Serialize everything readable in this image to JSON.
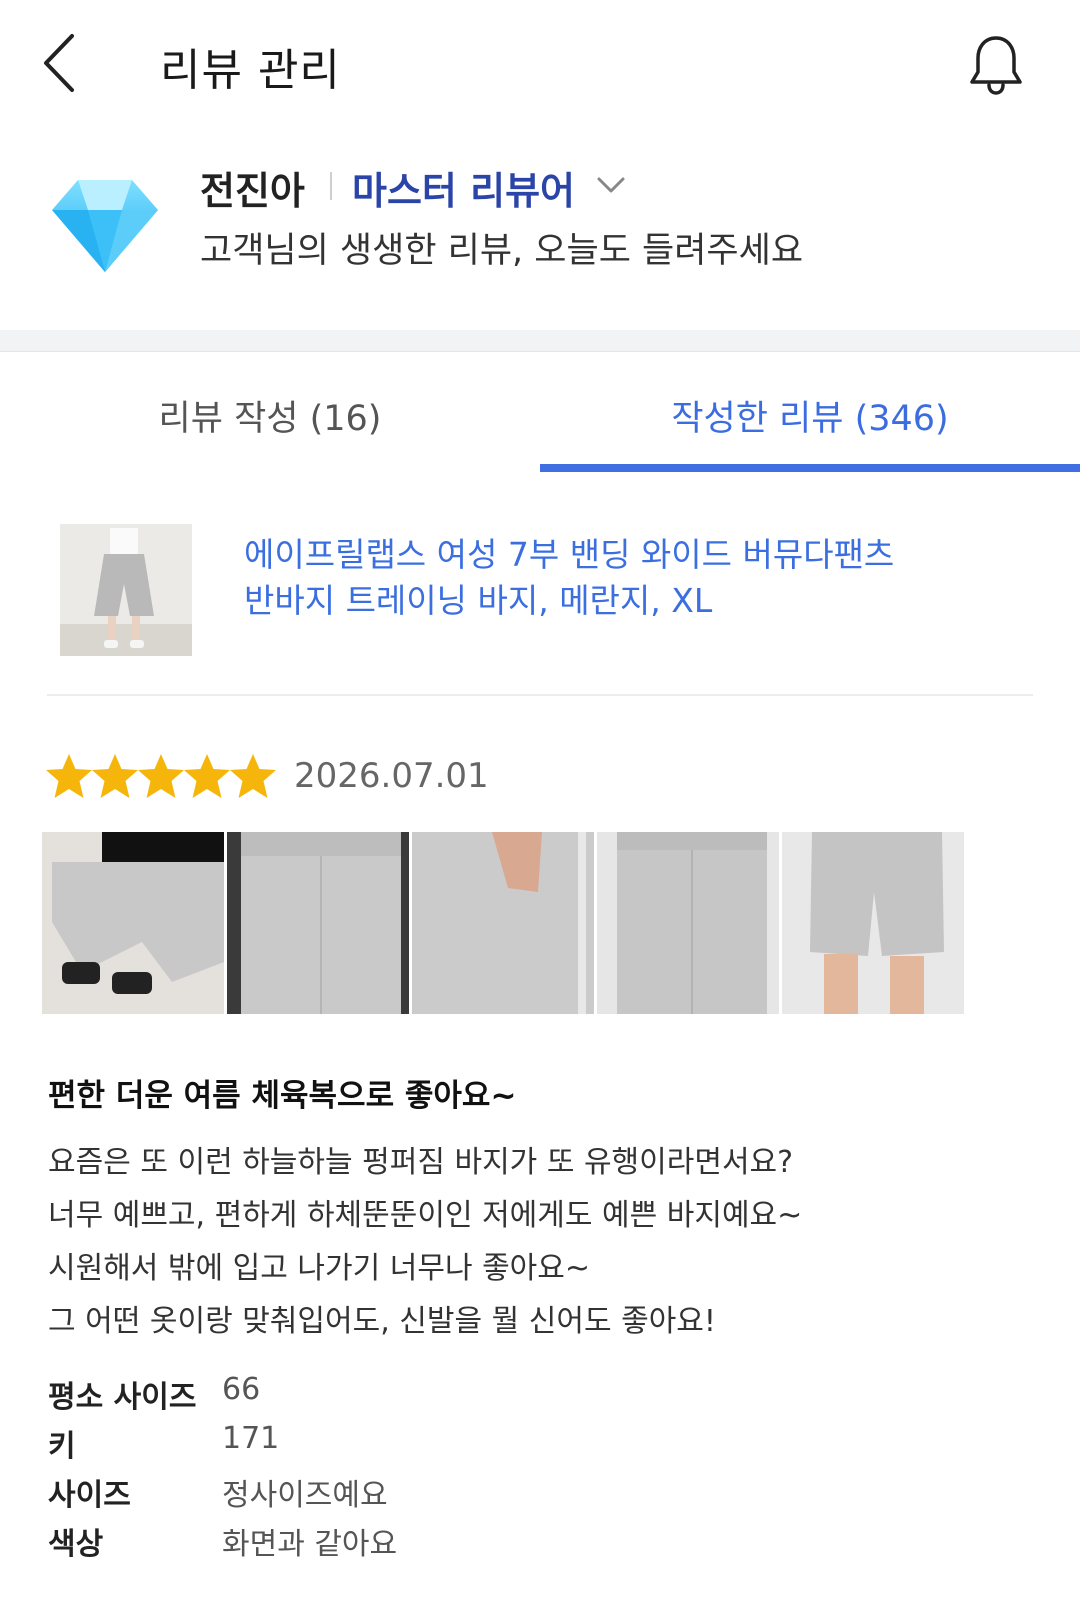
{
  "header": {
    "title": "리뷰 관리",
    "back_icon": "chevron-left-icon",
    "bell_icon": "bell-icon"
  },
  "profile": {
    "badge_icon": "diamond-icon",
    "name": "전진아",
    "grade": "마스터 리뷰어",
    "tagline": "고객님의 생생한 리뷰, 오늘도 들려주세요"
  },
  "tabs": [
    {
      "label": "리뷰 작성 (16)",
      "active": false
    },
    {
      "label": "작성한 리뷰 (346)",
      "active": true
    }
  ],
  "review": {
    "product_name_line1": "에이프릴랩스 여성 7부 밴딩 와이드 버뮤다팬츠",
    "product_name_line2": "반바지 트레이닝 바지, 메란지, XL",
    "rating": 5,
    "rating_max": 5,
    "date": "2026.07.01",
    "photo_count": 5,
    "title": "편한 더운 여름 체육복으로 좋아요~",
    "body": [
      "요즘은 또 이런 하늘하늘 펑퍼짐 바지가 또 유행이라면서요?",
      "너무 예쁘고, 편하게 하체뚠뚠이인 저에게도 예쁜 바지예요~",
      "시원해서 밖에 입고 나가기 너무나 좋아요~",
      "그 어떤 옷이랑 맞춰입어도, 신발을 뭘 신어도 좋아요!"
    ],
    "details": [
      {
        "label": "평소 사이즈",
        "value": "66"
      },
      {
        "label": "키",
        "value": "171"
      },
      {
        "label": "사이즈",
        "value": "정사이즈예요"
      },
      {
        "label": "색상",
        "value": "화면과 같아요"
      }
    ]
  },
  "colors": {
    "accent": "#3f6fe0",
    "grade": "#2b44a8",
    "star": "#f5b50a"
  }
}
